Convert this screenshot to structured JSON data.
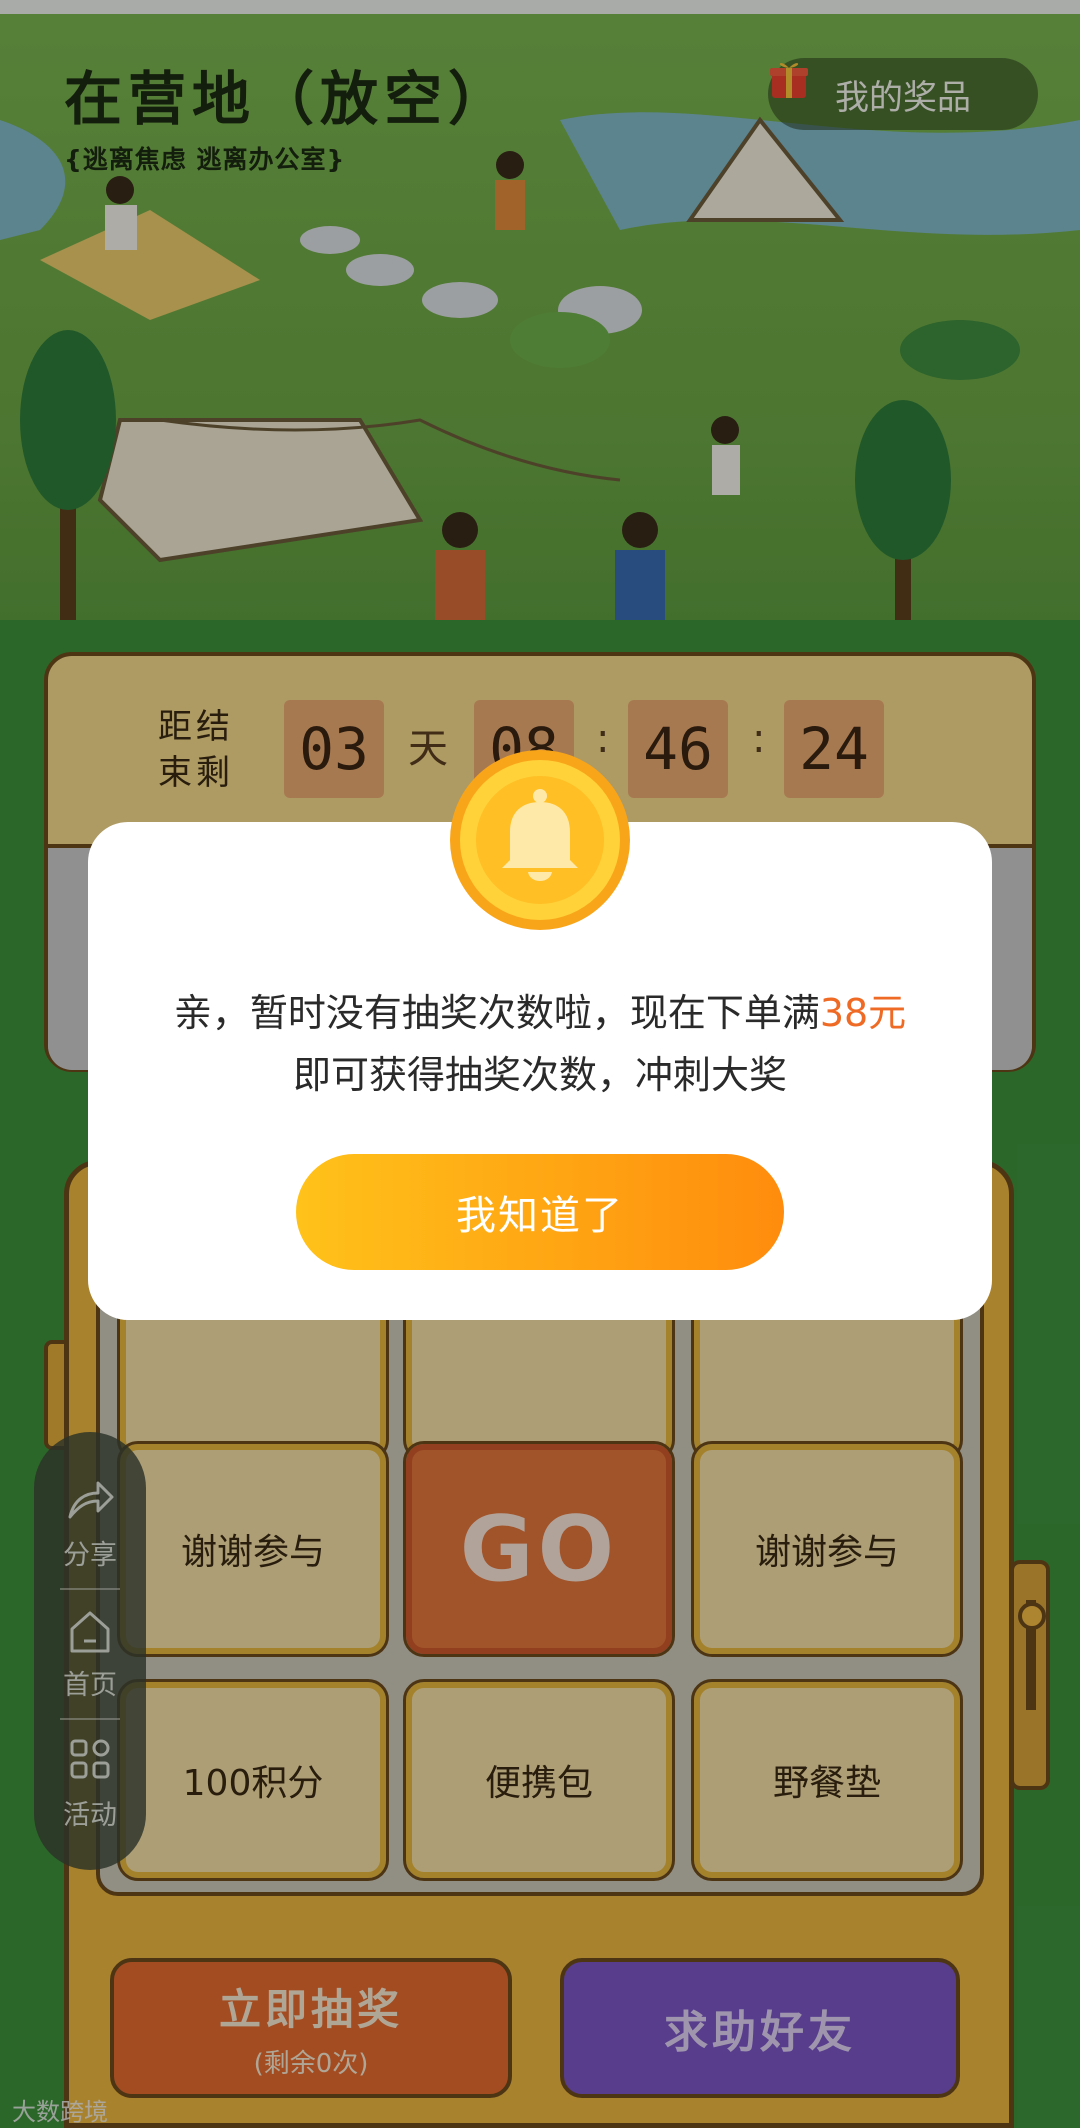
{
  "header": {
    "title": "在营地（放空）",
    "subtitle": "{逃离焦虑 逃离办公室}",
    "prize_button_label": "我的奖品",
    "prize_icon": "gift-icon"
  },
  "countdown": {
    "label": "距结束剩",
    "days": "03",
    "day_unit": "天",
    "hours": "08",
    "minutes": "46",
    "seconds": "24",
    "separator": ":"
  },
  "prize_grid": {
    "row2_left": "谢谢参与",
    "go_label": "GO",
    "row2_right": "谢谢参与",
    "row3_left": "100积分",
    "row3_middle": "便携包",
    "row3_right": "野餐垫"
  },
  "side_nav": {
    "items": [
      {
        "label": "分享",
        "icon": "share-icon"
      },
      {
        "label": "首页",
        "icon": "home-icon"
      },
      {
        "label": "活动",
        "icon": "activity-grid-icon"
      }
    ]
  },
  "actions": {
    "draw_label": "立即抽奖",
    "draw_remaining": "(剩余0次)",
    "help_label": "求助好友"
  },
  "modal": {
    "icon": "bell-icon",
    "message_part1": "亲，暂时没有抽奖次数啦，现在下单满",
    "message_highlight": "38元",
    "message_part2": "即可获得抽奖次数，冲刺大奖",
    "confirm_label": "我知道了"
  },
  "watermark": "大数跨境",
  "colors": {
    "accent_orange": "#ff8c0d",
    "highlight_text": "#ef6a24",
    "go_button": "#e0743a",
    "help_button": "#7a55c4"
  }
}
